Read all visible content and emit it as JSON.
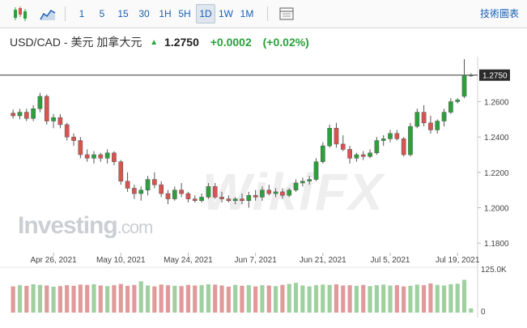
{
  "toolbar": {
    "timeframes": [
      "1",
      "5",
      "15",
      "30",
      "1H",
      "5H",
      "1D",
      "1W",
      "1M"
    ],
    "active": "1D",
    "tech_label": "技術圖表"
  },
  "quote": {
    "title": "USD/CAD - 美元 加拿大元",
    "price": "1.2750",
    "change": "+0.0002",
    "change_pct": "(+0.02%)"
  },
  "watermark": {
    "brand": "Investing",
    "suffix": ".com",
    "wm2": "WikiFX"
  },
  "colors": {
    "up": "#2ba13b",
    "down": "#d9534f",
    "up_vol": "#9fd09f",
    "down_vol": "#e09a9a"
  },
  "chart_data": {
    "type": "candlestick",
    "price_ticks": [
      "1.2750",
      "1.2600",
      "1.2400",
      "1.2200",
      "1.2000",
      "1.1800"
    ],
    "price_range": [
      1.1755,
      1.2845
    ],
    "current_price": 1.275,
    "x_labels": [
      "Apr 26, 2021",
      "May 10, 2021",
      "May 24, 2021",
      "Jun 7, 2021",
      "Jun 21, 2021",
      "Jul 5, 2021",
      "Jul 19, 2021"
    ],
    "x_label_index": [
      6,
      16,
      26,
      36,
      46,
      56,
      66
    ],
    "volume_ticks": [
      "125.0K",
      "0"
    ],
    "volume_max": 125000,
    "candles": [
      [
        1.2535,
        1.2555,
        1.2505,
        1.252
      ],
      [
        1.252,
        1.256,
        1.25,
        1.254
      ],
      [
        1.254,
        1.256,
        1.249,
        1.2505
      ],
      [
        1.2505,
        1.258,
        1.249,
        1.256
      ],
      [
        1.256,
        1.265,
        1.254,
        1.263
      ],
      [
        1.263,
        1.264,
        1.247,
        1.249
      ],
      [
        1.249,
        1.253,
        1.245,
        1.251
      ],
      [
        1.251,
        1.253,
        1.245,
        1.247
      ],
      [
        1.247,
        1.248,
        1.238,
        1.24
      ],
      [
        1.24,
        1.242,
        1.235,
        1.238
      ],
      [
        1.238,
        1.24,
        1.228,
        1.23
      ],
      [
        1.23,
        1.233,
        1.226,
        1.228
      ],
      [
        1.228,
        1.232,
        1.225,
        1.23
      ],
      [
        1.23,
        1.231,
        1.226,
        1.228
      ],
      [
        1.228,
        1.233,
        1.225,
        1.231
      ],
      [
        1.231,
        1.232,
        1.224,
        1.226
      ],
      [
        1.226,
        1.227,
        1.213,
        1.215
      ],
      [
        1.215,
        1.22,
        1.209,
        1.211
      ],
      [
        1.211,
        1.213,
        1.205,
        1.208
      ],
      [
        1.208,
        1.212,
        1.204,
        1.21
      ],
      [
        1.21,
        1.218,
        1.207,
        1.216
      ],
      [
        1.216,
        1.22,
        1.211,
        1.213
      ],
      [
        1.213,
        1.215,
        1.206,
        1.208
      ],
      [
        1.208,
        1.21,
        1.202,
        1.205
      ],
      [
        1.205,
        1.212,
        1.204,
        1.21
      ],
      [
        1.21,
        1.214,
        1.206,
        1.208
      ],
      [
        1.208,
        1.209,
        1.203,
        1.205
      ],
      [
        1.205,
        1.207,
        1.203,
        1.204
      ],
      [
        1.204,
        1.208,
        1.203,
        1.206
      ],
      [
        1.206,
        1.214,
        1.205,
        1.212
      ],
      [
        1.212,
        1.214,
        1.205,
        1.206
      ],
      [
        1.206,
        1.209,
        1.203,
        1.205
      ],
      [
        1.205,
        1.207,
        1.203,
        1.204
      ],
      [
        1.204,
        1.206,
        1.202,
        1.205
      ],
      [
        1.205,
        1.208,
        1.202,
        1.204
      ],
      [
        1.204,
        1.209,
        1.2,
        1.207
      ],
      [
        1.207,
        1.21,
        1.204,
        1.206
      ],
      [
        1.206,
        1.212,
        1.204,
        1.21
      ],
      [
        1.21,
        1.213,
        1.207,
        1.208
      ],
      [
        1.208,
        1.211,
        1.206,
        1.209
      ],
      [
        1.209,
        1.211,
        1.205,
        1.207
      ],
      [
        1.207,
        1.211,
        1.206,
        1.21
      ],
      [
        1.21,
        1.216,
        1.209,
        1.214
      ],
      [
        1.214,
        1.217,
        1.212,
        1.215
      ],
      [
        1.215,
        1.218,
        1.213,
        1.216
      ],
      [
        1.216,
        1.228,
        1.215,
        1.226
      ],
      [
        1.226,
        1.237,
        1.225,
        1.235
      ],
      [
        1.235,
        1.247,
        1.234,
        1.245
      ],
      [
        1.245,
        1.248,
        1.234,
        1.236
      ],
      [
        1.236,
        1.241,
        1.232,
        1.233
      ],
      [
        1.233,
        1.235,
        1.225,
        1.228
      ],
      [
        1.228,
        1.231,
        1.226,
        1.23
      ],
      [
        1.23,
        1.232,
        1.227,
        1.229
      ],
      [
        1.229,
        1.233,
        1.228,
        1.231
      ],
      [
        1.231,
        1.24,
        1.23,
        1.238
      ],
      [
        1.238,
        1.241,
        1.235,
        1.239
      ],
      [
        1.239,
        1.244,
        1.237,
        1.242
      ],
      [
        1.242,
        1.244,
        1.238,
        1.239
      ],
      [
        1.239,
        1.24,
        1.229,
        1.23
      ],
      [
        1.23,
        1.248,
        1.229,
        1.246
      ],
      [
        1.246,
        1.256,
        1.245,
        1.254
      ],
      [
        1.254,
        1.258,
        1.246,
        1.248
      ],
      [
        1.248,
        1.252,
        1.242,
        1.244
      ],
      [
        1.244,
        1.25,
        1.242,
        1.249
      ],
      [
        1.249,
        1.256,
        1.246,
        1.254
      ],
      [
        1.254,
        1.262,
        1.253,
        1.26
      ],
      [
        1.26,
        1.262,
        1.259,
        1.261
      ],
      [
        1.263,
        1.284,
        1.262,
        1.275
      ],
      [
        1.275,
        1.276,
        1.274,
        1.275
      ]
    ],
    "volumes": [
      88000,
      92000,
      90000,
      95000,
      93000,
      91000,
      87000,
      89000,
      92000,
      90000,
      94000,
      93000,
      95000,
      91000,
      89000,
      92000,
      96000,
      90000,
      93000,
      105000,
      91000,
      88000,
      94000,
      92000,
      90000,
      89000,
      93000,
      91000,
      92000,
      95000,
      94000,
      91000,
      87000,
      93000,
      90000,
      92000,
      88000,
      92000,
      91000,
      89000,
      93000,
      96000,
      100000,
      91000,
      88000,
      92000,
      94000,
      93000,
      95000,
      91000,
      92000,
      90000,
      93000,
      89000,
      92000,
      94000,
      91000,
      92000,
      88000,
      90000,
      94000,
      92000,
      98000,
      93000,
      91000,
      95000,
      97000,
      110000,
      14000
    ]
  }
}
